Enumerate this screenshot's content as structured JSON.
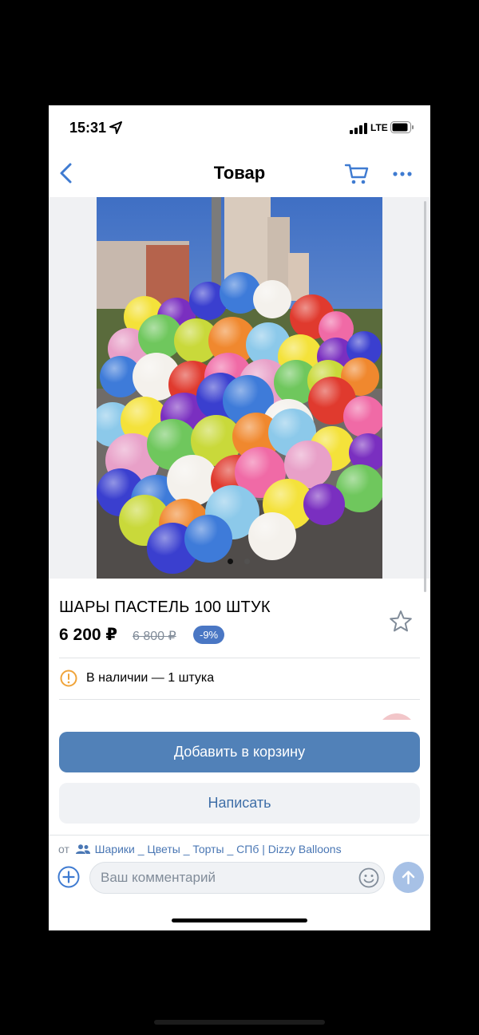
{
  "status_bar": {
    "time": "15:31",
    "network": "LTE"
  },
  "nav": {
    "title": "Товар"
  },
  "gallery": {
    "photo_count": 2,
    "active_index": 0
  },
  "product": {
    "name": "ШАРЫ ПАСТЕЛЬ 100 ШТУК",
    "price": "6 200 ₽",
    "old_price": "6 800 ₽",
    "discount": "-9%",
    "availability": "В наличии — 1 штука"
  },
  "actions": {
    "add_to_cart": "Добавить в корзину",
    "write": "Написать"
  },
  "comment_bar": {
    "from_prefix": "от",
    "group_name": "Шарики _ Цветы _ Торты _ СПб | Dizzy Balloons",
    "placeholder": "Ваш комментарий"
  },
  "colors": {
    "accent": "#5181b8",
    "discount_badge": "#4a77c4",
    "link": "#4a77b4",
    "secondary_text": "#818c99",
    "availability_icon": "#f0a43a"
  },
  "icons": [
    "location-arrow-icon",
    "signal-icon",
    "battery-icon",
    "back-chevron-icon",
    "cart-icon",
    "more-icon",
    "star-icon",
    "warning-circle-icon",
    "group-people-icon",
    "add-circle-icon",
    "smile-icon",
    "send-arrow-icon"
  ]
}
